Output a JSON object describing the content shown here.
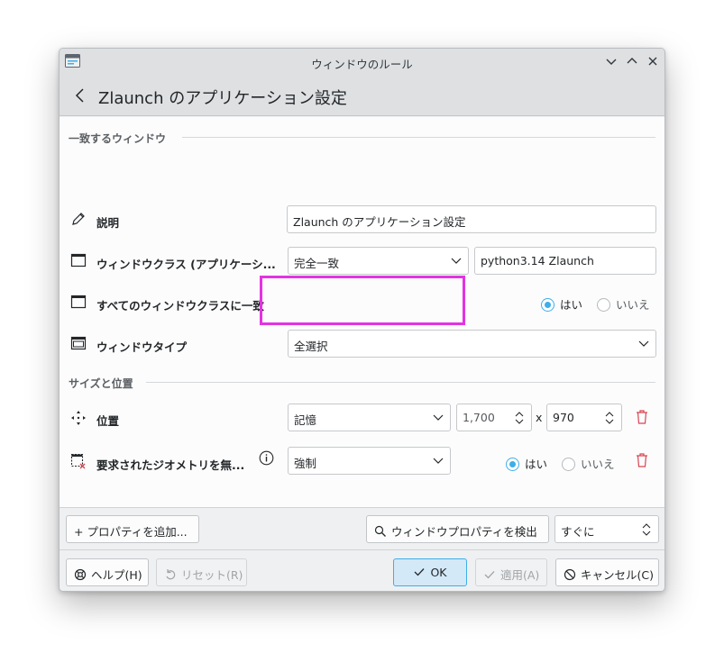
{
  "window": {
    "title": "ウィンドウのルール",
    "header_title": "Zlaunch のアプリケーション設定"
  },
  "sections": {
    "match_window": "一致するウィンドウ",
    "size_position": "サイズと位置"
  },
  "rows": {
    "description": {
      "label": "説明",
      "value": "Zlaunch のアプリケーション設定"
    },
    "window_class": {
      "label": "ウィンドウクラス (アプリケーシ...",
      "match_mode": "完全一致",
      "value": "python3.14 Zlaunch"
    },
    "match_whole_class": {
      "label": "すべてのウィンドウクラスに一致",
      "yes": "はい",
      "no": "いいえ",
      "selected": "はい"
    },
    "window_type": {
      "label": "ウィンドウタイプ",
      "value": "全選択"
    },
    "position": {
      "label": "位置",
      "mode": "記憶",
      "x": "1,700",
      "separator": "x",
      "y": "970"
    },
    "ignore_geometry": {
      "label": "要求されたジオメトリを無...",
      "mode": "強制",
      "yes": "はい",
      "no": "いいえ",
      "selected": "はい"
    }
  },
  "footer": {
    "add_property": "+ プロパティを追加...",
    "detect_properties": "ウィンドウプロパティを検出",
    "detect_delay": "すぐに",
    "help": "ヘルプ(H)",
    "reset": "リセット(R)",
    "ok": "OK",
    "apply": "適用(A)",
    "cancel": "キャンセル(C)"
  },
  "colors": {
    "accent": "#3daee9",
    "delete": "#da4453",
    "highlight": "#e332e3"
  }
}
